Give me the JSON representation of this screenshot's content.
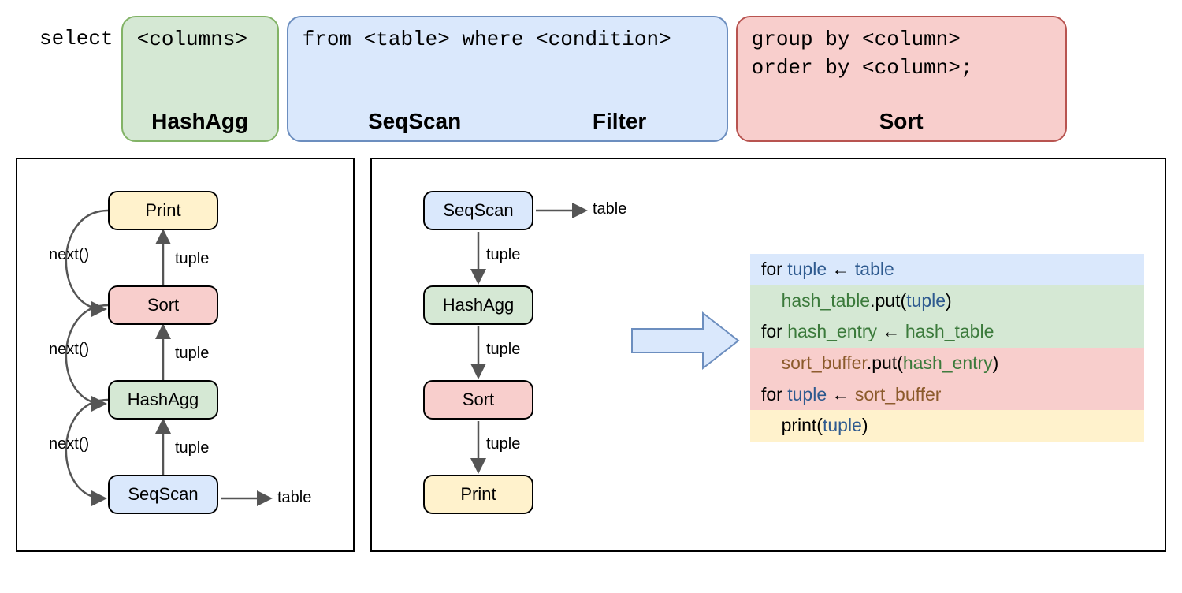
{
  "sql": {
    "select_keyword": "select",
    "columns_box": {
      "code": "<columns>",
      "op": "HashAgg"
    },
    "from_box": {
      "code": "from <table> where <condition>",
      "op1": "SeqScan",
      "op2": "Filter"
    },
    "group_box": {
      "code1": "group by <column>",
      "code2": "order by <column>;",
      "op": "Sort"
    }
  },
  "leftPanel": {
    "nodes": {
      "print": "Print",
      "sort": "Sort",
      "hashagg": "HashAgg",
      "seqscan": "SeqScan"
    },
    "labels": {
      "next": "next()",
      "tuple": "tuple",
      "table": "table"
    }
  },
  "rightPanel": {
    "nodes": {
      "seqscan": "SeqScan",
      "hashagg": "HashAgg",
      "sort": "Sort",
      "print": "Print"
    },
    "labels": {
      "tuple": "tuple",
      "table": "table"
    },
    "code": {
      "l1": {
        "for": "for ",
        "tuple": "tuple",
        "arrow": " ← ",
        "table": "table"
      },
      "l2": {
        "indent": "    ",
        "ht": "hash_table",
        "put": ".put(",
        "tuple": "tuple",
        "close": ")"
      },
      "l3": {
        "for": "for ",
        "he": "hash_entry",
        "arrow": " ← ",
        "ht": "hash_table"
      },
      "l4": {
        "indent": "    ",
        "sb": "sort_buffer",
        "put": ".put(",
        "he": "hash_entry",
        "close": ")"
      },
      "l5": {
        "for": "for ",
        "tuple": "tuple",
        "arrow": " ← ",
        "sb": "sort_buffer"
      },
      "l6": {
        "indent": "    ",
        "print": "print(",
        "tuple": "tuple",
        "close": ")"
      }
    }
  }
}
